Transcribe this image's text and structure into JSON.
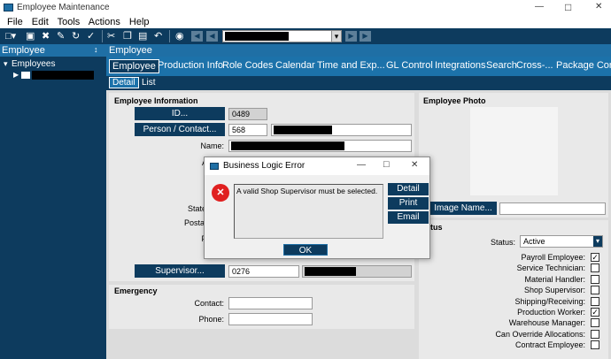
{
  "window": {
    "title": "Employee Maintenance",
    "controls": {
      "minimize": "—",
      "maximize": "□",
      "close": "✕"
    }
  },
  "menu": [
    "File",
    "Edit",
    "Tools",
    "Actions",
    "Help"
  ],
  "toolbar": {
    "icons": [
      "new-icon",
      "save-icon",
      "delete-icon",
      "attach-icon",
      "refresh-icon",
      "check-icon",
      "cut-icon",
      "copy-icon",
      "paste-icon",
      "undo-icon",
      "binoculars-icon",
      "first-record-icon",
      "previous-record-icon",
      "next-record-icon",
      "last-record-icon"
    ],
    "record_value": "",
    "dropdown_arrow": "▾"
  },
  "left_pane": {
    "header": "Employee",
    "pin": "↕",
    "tree_root": "Employees",
    "tree_child_value": ""
  },
  "main": {
    "header": "Employee",
    "tabs": [
      "Employee",
      "Production Info",
      "Role Codes",
      "Calendar",
      "Time and Exp...",
      "GL Control",
      "Integrations",
      "Search",
      "Cross-...",
      "Package Contro"
    ],
    "subtabs": [
      "Detail",
      "List"
    ],
    "info": {
      "title": "Employee Information",
      "id_button": "ID...",
      "id_value": "0489",
      "person_button": "Person / Contact...",
      "person_value": "568",
      "name_label": "Name:",
      "address_label_fragment": "Ad",
      "state_label_fragment": "State",
      "postal_label_fragment": "Postal",
      "phone_label_fragment": "F",
      "supervisor_button": "Supervisor...",
      "supervisor_value": "0276"
    },
    "photo": {
      "title": "Employee Photo",
      "image_button": "Image Name..."
    },
    "status": {
      "title_fragment": "tatus",
      "status_label": "Status:",
      "status_value": "Active",
      "checkboxes": [
        {
          "label": "Payroll Employee:",
          "checked": true
        },
        {
          "label": "Service Technician:",
          "checked": false
        },
        {
          "label": "Material Handler:",
          "checked": false
        },
        {
          "label": "Shop Supervisor:",
          "checked": false
        },
        {
          "label": "Shipping/Receiving:",
          "checked": false
        },
        {
          "label": "Production Worker:",
          "checked": true
        },
        {
          "label": "Warehouse Manager:",
          "checked": false
        },
        {
          "label": "Can Override Allocations:",
          "checked": false
        },
        {
          "label": "Contract Employee:",
          "checked": false
        }
      ]
    },
    "emergency": {
      "title": "Emergency",
      "contact_label": "Contact:",
      "phone_label": "Phone:"
    }
  },
  "dialog": {
    "title": "Business Logic Error",
    "message": "A valid Shop Supervisor must be selected.",
    "buttons": [
      "Detail",
      "Print",
      "Email"
    ],
    "ok": "OK",
    "error_glyph": "✕",
    "controls": {
      "minimize": "—",
      "maximize": "□",
      "close": "✕"
    }
  },
  "colors": {
    "toolbar_bg": "#0d3b5e",
    "accent_blue": "#1f6fa5",
    "tab_bar": "#1c72aa",
    "error_red": "#e02020"
  }
}
